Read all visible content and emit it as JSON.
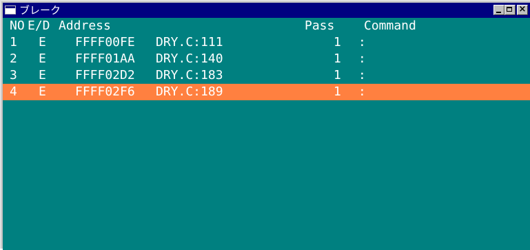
{
  "window": {
    "title": "ブレーク",
    "close_glyph": "×"
  },
  "header": {
    "no": "NO",
    "ed": "E/D",
    "address": "Address",
    "pass": "Pass",
    "command": "Command"
  },
  "rows": [
    {
      "no": "1",
      "ed": "E",
      "address": "FFFF00FE",
      "location": "DRY.C:111",
      "pass": "1",
      "command": ":"
    },
    {
      "no": "2",
      "ed": "E",
      "address": "FFFF01AA",
      "location": "DRY.C:140",
      "pass": "1",
      "command": ":"
    },
    {
      "no": "3",
      "ed": "E",
      "address": "FFFF02D2",
      "location": "DRY.C:183",
      "pass": "1",
      "command": ":"
    },
    {
      "no": "4",
      "ed": "E",
      "address": "FFFF02F6",
      "location": "DRY.C:189",
      "pass": "1",
      "command": ":"
    }
  ],
  "colors": {
    "titlebar": "#000080",
    "background": "#008080",
    "selected_row": "#ff8040",
    "text": "#ffffff"
  },
  "icons": [
    "window-icon",
    "minimize-icon",
    "maximize-icon",
    "close-icon"
  ]
}
